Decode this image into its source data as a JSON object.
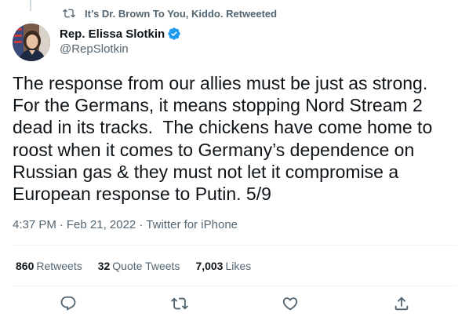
{
  "retweet_context": {
    "icon": "retweet-icon",
    "text": "It’s Dr. Brown To You, Kiddo. Retweeted"
  },
  "author": {
    "display_name": "Rep. Elissa Slotkin",
    "handle": "@RepSlotkin",
    "verified": true,
    "verified_color": "#1d9bf0"
  },
  "tweet": {
    "text": "The response from our allies must be just as strong.\nFor the Germans, it means stopping Nord Stream 2\ndead in its tracks.  The chickens have come home to\nroost when it comes to Germany’s dependence on\nRussian gas & they must not let it compromise a\nEuropean response to Putin. 5/9",
    "time": "4:37 PM",
    "separator": "·",
    "date": "Feb 21, 2022",
    "source": "Twitter for iPhone"
  },
  "stats": {
    "retweets_count": "860",
    "retweets_label": "Retweets",
    "quotes_count": "32",
    "quotes_label": "Quote Tweets",
    "likes_count": "7,003",
    "likes_label": "Likes"
  },
  "actions": {
    "reply_icon": "reply-icon",
    "retweet_icon": "retweet-icon",
    "like_icon": "heart-icon",
    "share_icon": "share-icon"
  },
  "colors": {
    "text_primary": "#0f1419",
    "text_secondary": "#536471",
    "divider": "#eff3f4"
  }
}
